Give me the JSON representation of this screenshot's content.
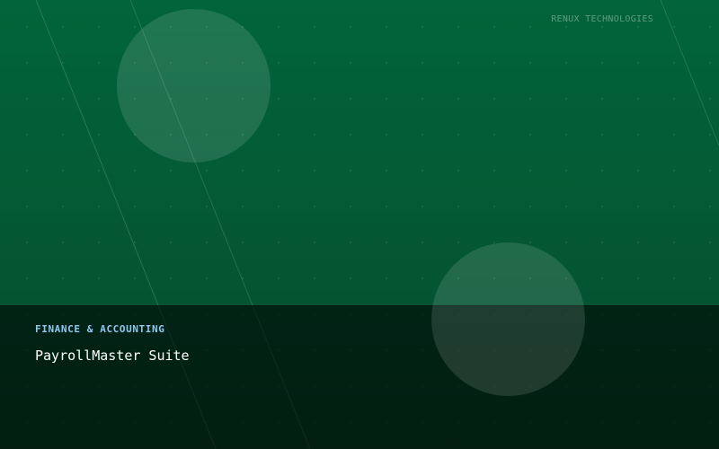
{
  "brand": {
    "name": "RENUX TECHNOLOGIES",
    "color": "#5e9c7c"
  },
  "card": {
    "category": "FINANCE & ACCOUNTING",
    "category_color": "#8ec9f0",
    "title": "PayrollMaster Suite"
  },
  "colors": {
    "background_top": "#02643a",
    "background_bottom": "#054b2c",
    "band": "#012414"
  }
}
